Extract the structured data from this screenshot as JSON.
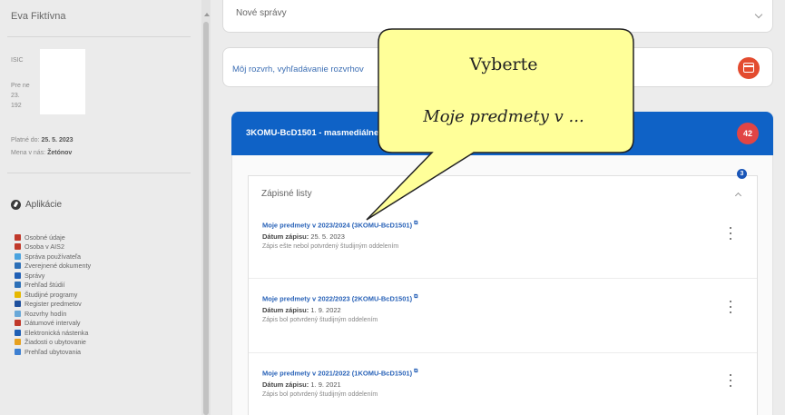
{
  "sidebar": {
    "user_name": "Eva Fiktívna",
    "info_lines": [
      "ISIC",
      "Pre             ne",
      "23.",
      "192"
    ],
    "valid_label": "Platné do:",
    "valid_value": "25. 5. 2023",
    "currency_label": "Mena v nás:",
    "currency_value": "Žetónov",
    "apps_heading": "Aplikácie",
    "apps": [
      {
        "label": "Osobné údaje",
        "icon": "person-icon",
        "color": "#c0392b"
      },
      {
        "label": "Osoba v AIS2",
        "icon": "person-icon",
        "color": "#c0392b"
      },
      {
        "label": "Správa používateľa",
        "icon": "user-settings-icon",
        "color": "#4aa3df"
      },
      {
        "label": "Zverejnené dokumenty",
        "icon": "document-icon",
        "color": "#2c6fb7"
      },
      {
        "label": "Správy",
        "icon": "messages-icon",
        "color": "#1f5fb5"
      },
      {
        "label": "Prehľad štúdií",
        "icon": "study-overview-icon",
        "color": "#2c6fb7"
      },
      {
        "label": "Študijné programy",
        "icon": "study-programs-icon",
        "color": "#e6b800"
      },
      {
        "label": "Register predmetov",
        "icon": "course-register-icon",
        "color": "#1e4f9c"
      },
      {
        "label": "Rozvrhy hodín",
        "icon": "timetable-icon",
        "color": "#69a8d8"
      },
      {
        "label": "Dátumové intervaly",
        "icon": "date-intervals-icon",
        "color": "#c0392b"
      },
      {
        "label": "Elektronická nástenka",
        "icon": "noticeboard-icon",
        "color": "#1f5fb5"
      },
      {
        "label": "Žiadosti o ubytovanie",
        "icon": "accommodation-icon",
        "color": "#e6a020"
      },
      {
        "label": "Prehľad ubytovania",
        "icon": "accommodation-overview-icon",
        "color": "#3d7fd1"
      }
    ]
  },
  "main": {
    "top_card_label": "Nové správy",
    "search_link": "Môj rozvrh, vyhľadávanie rozvrhov",
    "study_bar_title": "3KOMU-BcD1501 - masmediálne štúdiá",
    "count_badge": "42",
    "notification_count": "3",
    "panel_title": "Zápisné listy",
    "date_label": "Dátum zápisu:",
    "sheets": [
      {
        "title": "Moje predmety v 2023/2024 (3KOMU-BcD1501)",
        "date": "25. 5. 2023",
        "status": "Zápis ešte nebol potvrdený študijným oddelením"
      },
      {
        "title": "Moje predmety v 2022/2023 (2KOMU-BcD1501)",
        "date": "1. 9. 2022",
        "status": "Zápis bol potvrdený študijným oddelením"
      },
      {
        "title": "Moje predmety v 2021/2022 (1KOMU-BcD1501)",
        "date": "1. 9. 2021",
        "status": "Zápis bol potvrdený študijným oddelením"
      }
    ]
  },
  "callout": {
    "title": "Vyberte",
    "text": "Moje predmety v ..."
  },
  "colors": {
    "primary_blue": "#0f62c6",
    "badge_red": "#e14545",
    "callout_fill": "#ffff99"
  }
}
